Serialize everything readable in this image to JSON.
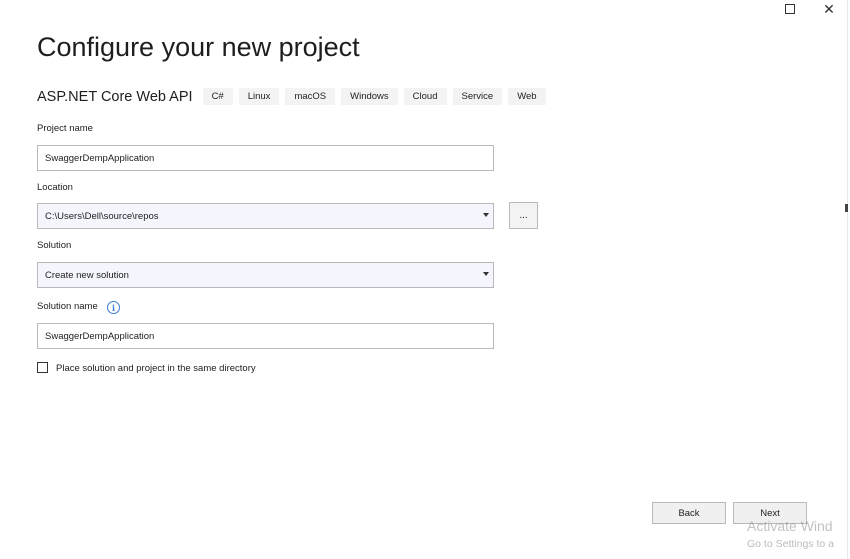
{
  "window": {
    "maximize_icon": "maximize-icon",
    "close_icon": "close-icon",
    "close_glyph": "✕"
  },
  "header": {
    "title": "Configure your new project",
    "template_name": "ASP.NET Core Web API",
    "tags": [
      "C#",
      "Linux",
      "macOS",
      "Windows",
      "Cloud",
      "Service",
      "Web"
    ]
  },
  "form": {
    "project_name_label": "Project name",
    "project_name_value": "SwaggerDempApplication",
    "location_label": "Location",
    "location_value": "C:\\Users\\Dell\\source\\repos",
    "browse_label": "...",
    "solution_label": "Solution",
    "solution_value": "Create new solution",
    "solution_name_label": "Solution name",
    "info_glyph": "i",
    "solution_name_value": "SwaggerDempApplication",
    "same_dir_label": "Place solution and project in the same directory",
    "same_dir_checked": false
  },
  "footer": {
    "back_label": "Back",
    "next_label": "Next"
  },
  "watermark": {
    "line1": "Activate Wind",
    "line2": "Go to Settings to a"
  },
  "colors": {
    "select_bg": "#f5f6fd",
    "info_blue": "#3b7bd1"
  }
}
